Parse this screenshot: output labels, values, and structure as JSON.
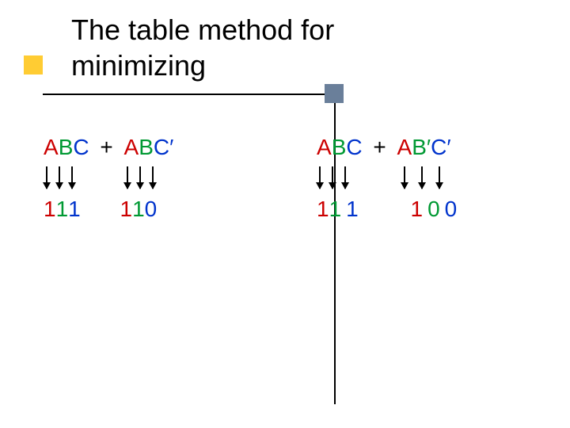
{
  "title": {
    "line1": "The table method for",
    "line2": "minimizing"
  },
  "left": {
    "term1": {
      "A": "A",
      "B": "B",
      "C": "C"
    },
    "plus": "+",
    "term2": {
      "A": "A",
      "B": "B",
      "Cprime": "C′"
    },
    "bits1": {
      "a": "1",
      "b": "1",
      "c": "1"
    },
    "bits2": {
      "a": "1",
      "b": "1",
      "c": "0"
    }
  },
  "right": {
    "term1": {
      "A": "A",
      "B": "B",
      "C": "C"
    },
    "plus": "+",
    "term2": {
      "A": "A",
      "Bprime": "B′",
      "Cprime": "C′"
    },
    "bits1": {
      "a": "1",
      "b": "1",
      "c": "1"
    },
    "bits2": {
      "a": "1",
      "b": "0",
      "c": "0"
    }
  }
}
